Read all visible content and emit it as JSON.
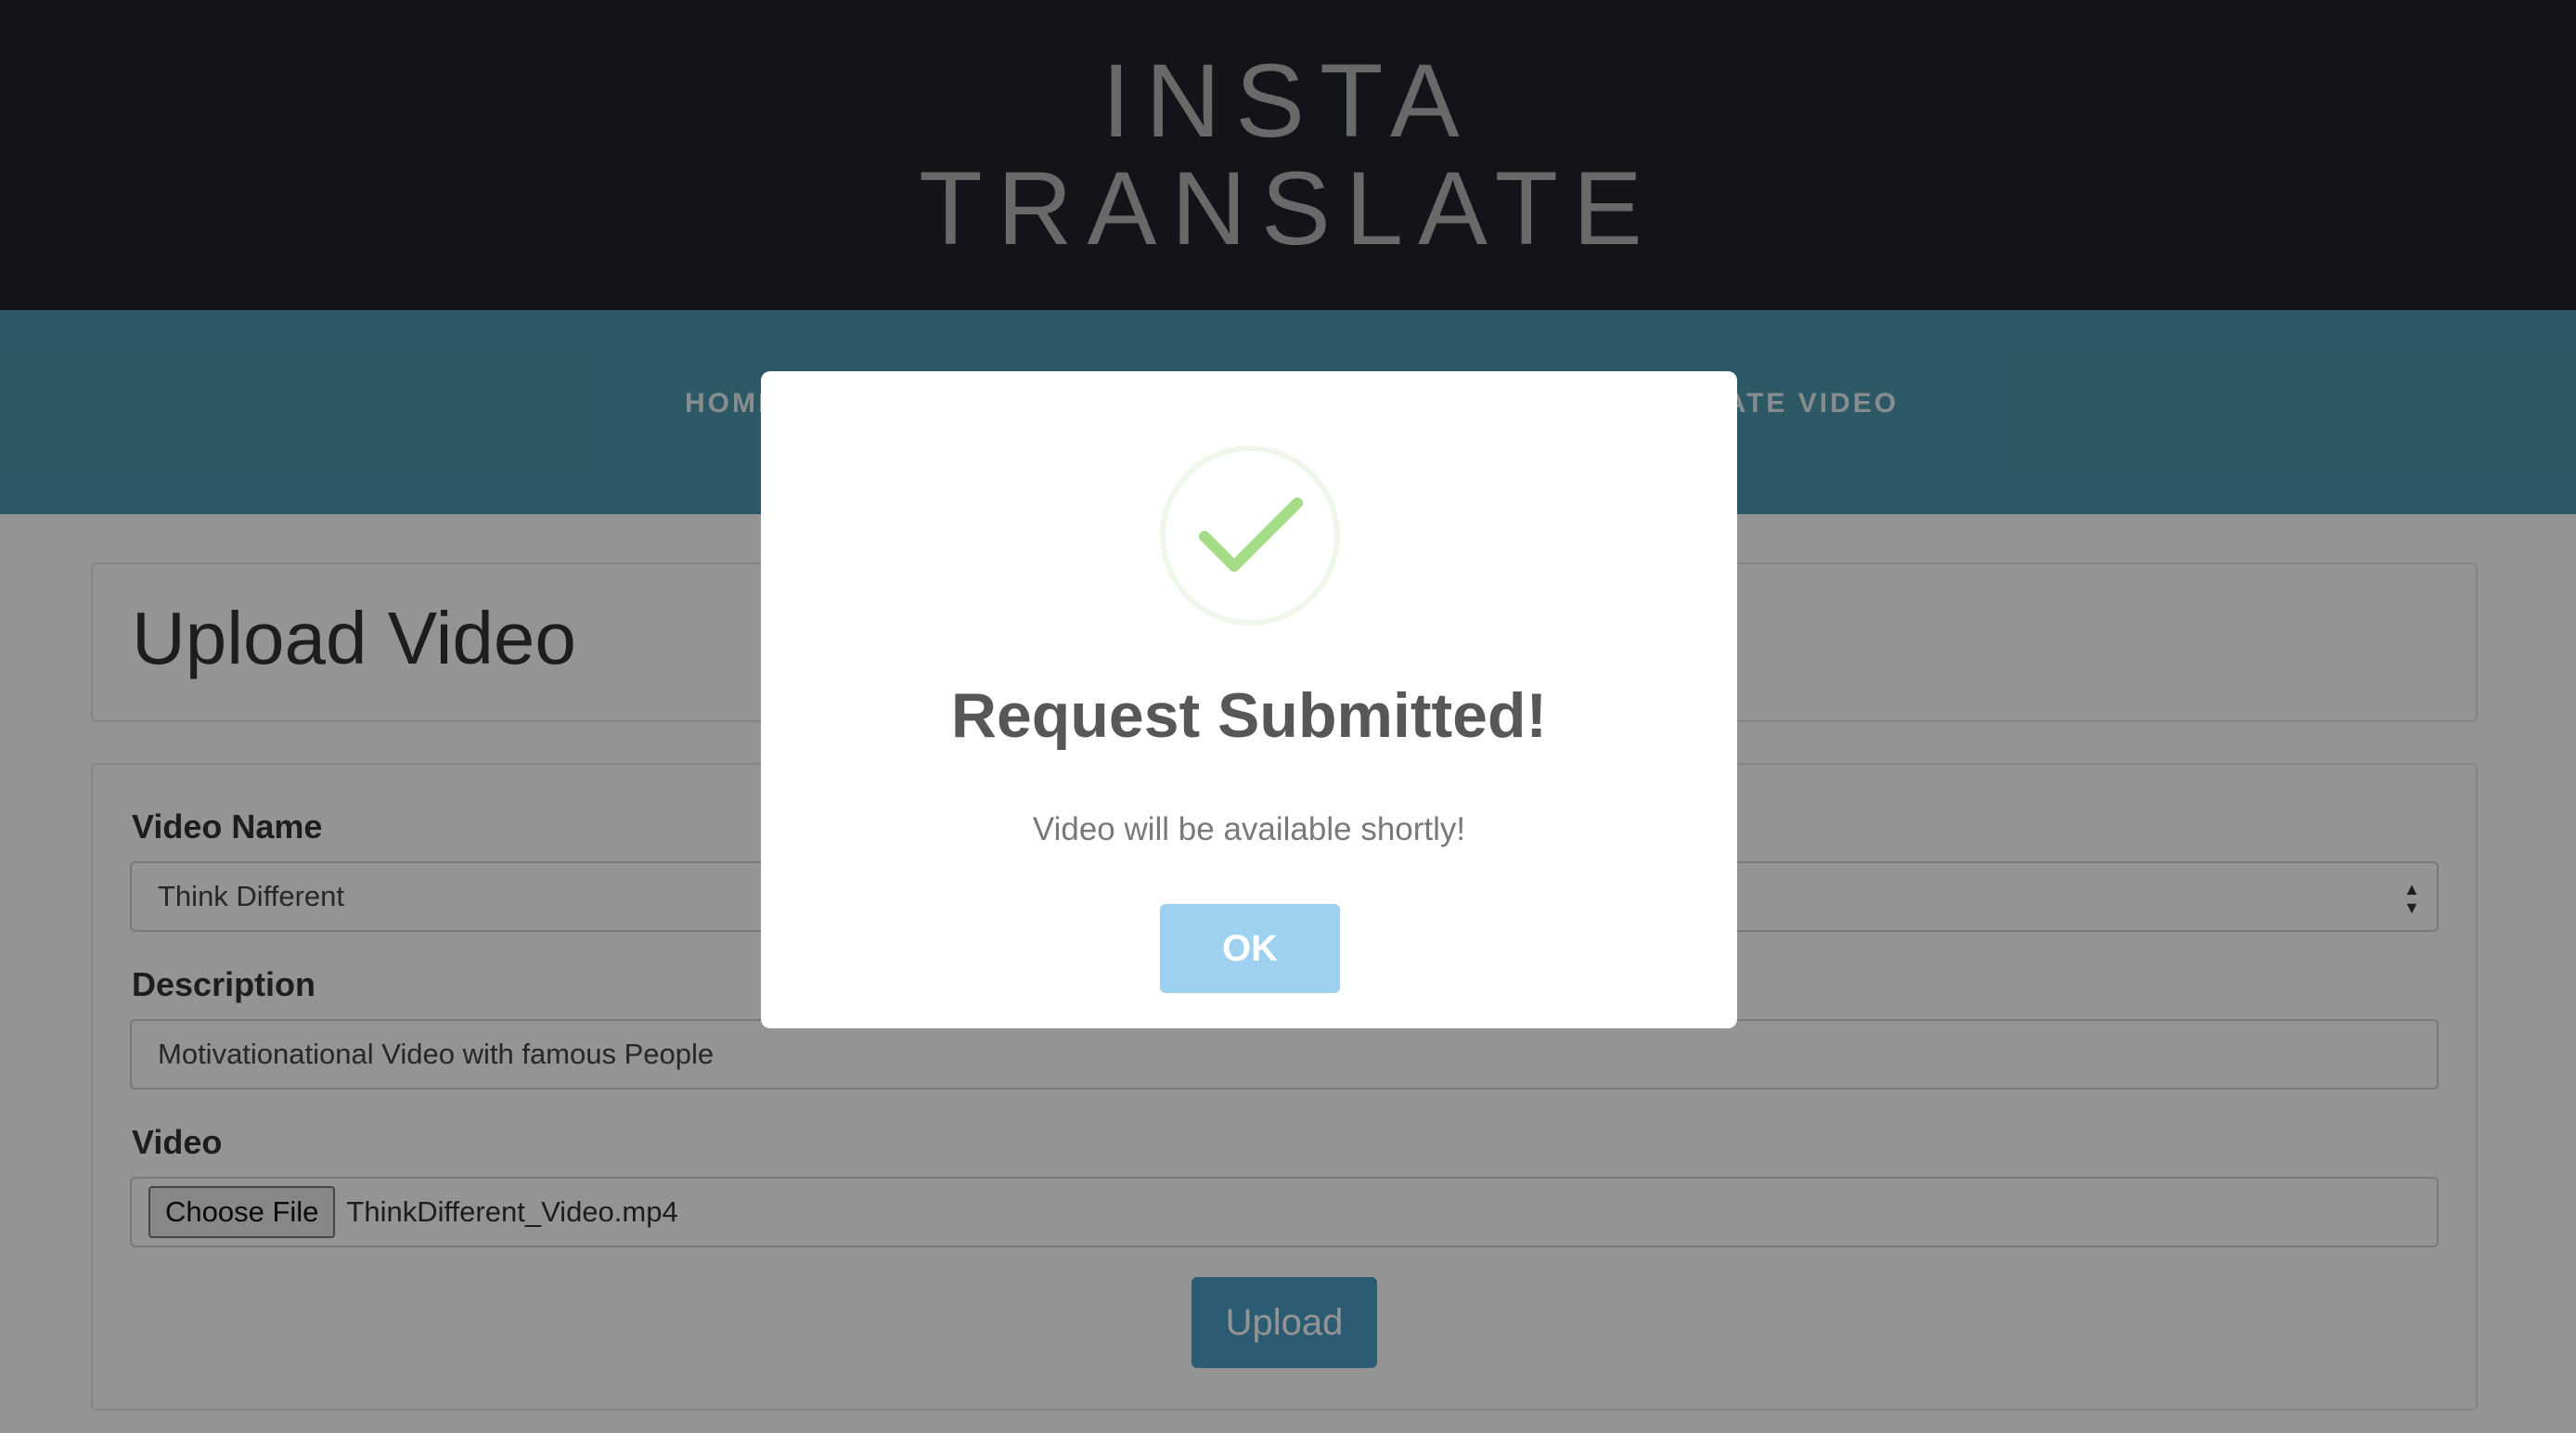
{
  "header": {
    "brand_line1": "INSTA",
    "brand_line2": "TRANSLATE"
  },
  "nav": {
    "home_label": "HOME",
    "translate_label": "TRANSLATE VIDEO"
  },
  "page": {
    "title": "Upload Video"
  },
  "form": {
    "video_name_label": "Video Name",
    "video_name_value": "Think Different",
    "description_label": "Description",
    "description_value": "Motivationational Video with famous People",
    "video_label": "Video",
    "choose_file_label": "Choose File",
    "file_name": "ThinkDifferent_Video.mp4",
    "upload_label": "Upload"
  },
  "modal": {
    "icon": "checkmark-circle-icon",
    "title": "Request Submitted!",
    "message": "Video will be available shortly!",
    "ok_label": "OK"
  },
  "colors": {
    "header_bg": "#1f232c",
    "nav_bg": "#4d99ae",
    "success_green": "#a5dc86",
    "ok_button": "#9ed0ef",
    "upload_button": "#4a9fc7"
  }
}
